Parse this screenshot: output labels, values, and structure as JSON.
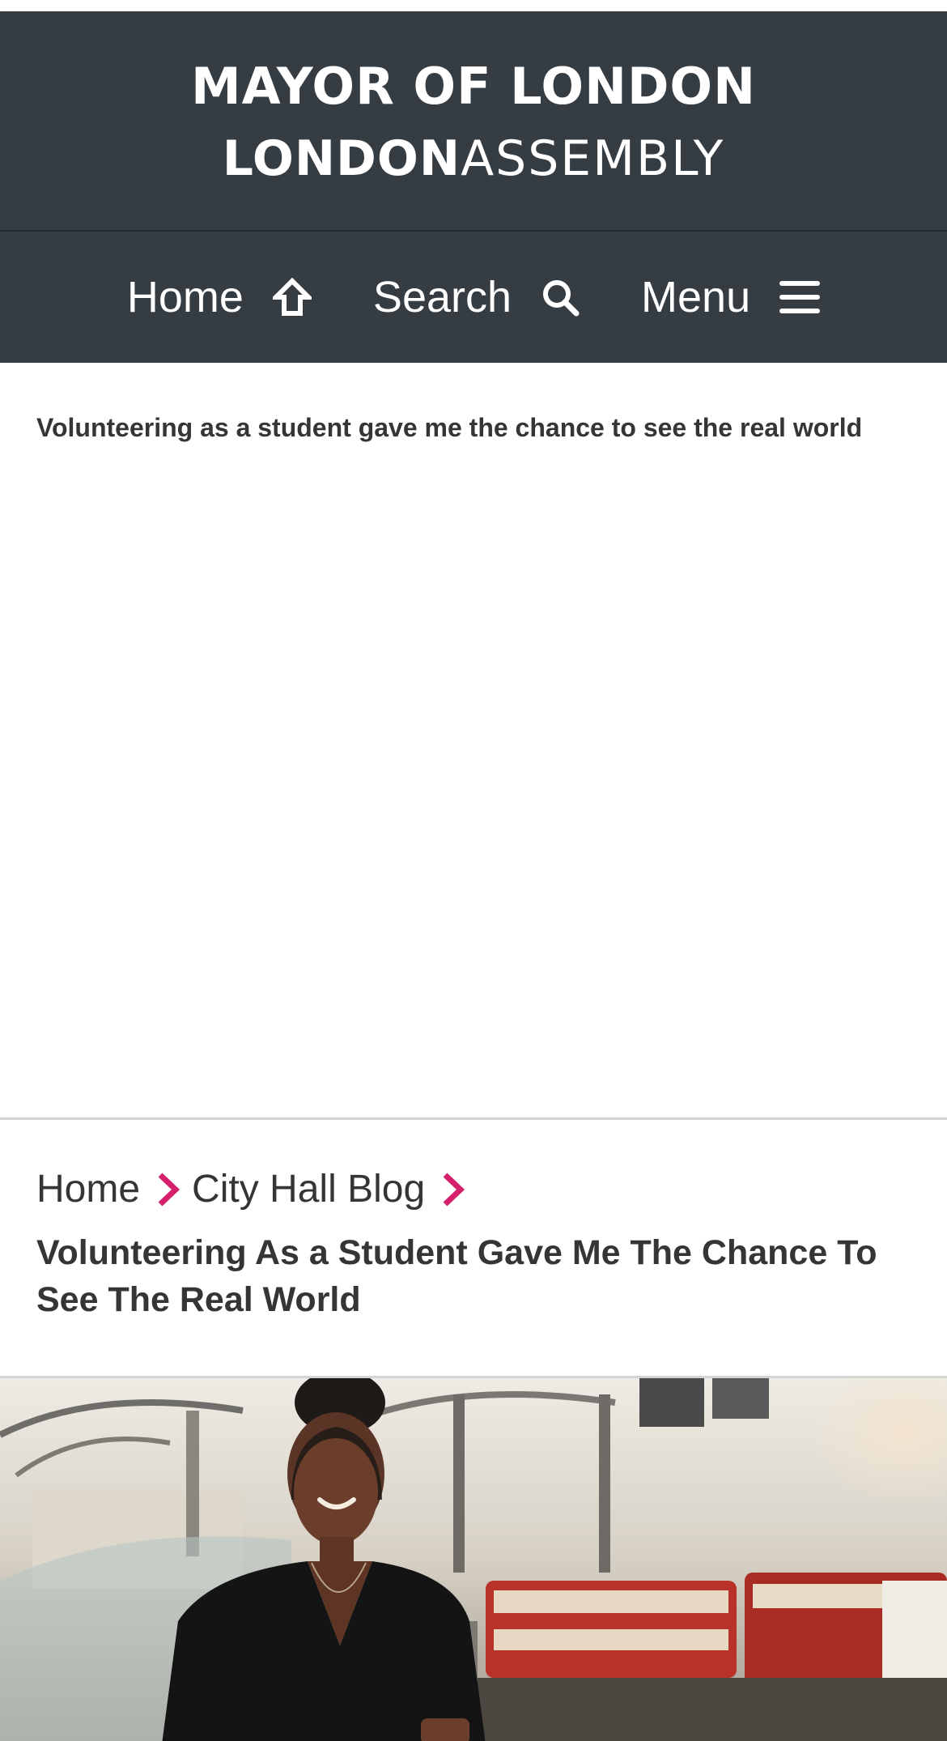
{
  "brand": {
    "mayor": "MAYOR OF LONDON",
    "assembly_strong": "LONDON",
    "assembly_light": "ASSEMBLY"
  },
  "nav": {
    "home_label": "Home",
    "home_icon": "home-icon",
    "search_label": "Search",
    "search_icon": "search-icon",
    "menu_label": "Menu",
    "menu_icon": "hamburger-menu-icon"
  },
  "article": {
    "title": "Volunteering as a student gave me the chance to see the real world"
  },
  "breadcrumb": {
    "items": [
      "Home",
      "City Hall Blog"
    ],
    "current": "Volunteering As a Student Gave Me The Chance To See The Real World",
    "separator_icon": "chevron-right-icon"
  },
  "colors": {
    "header_bg": "#353c42",
    "accent": "#d5206c",
    "text": "#353535"
  },
  "hero": {
    "image_subject": "smiling woman in black top inside transport museum with vintage red buses"
  }
}
